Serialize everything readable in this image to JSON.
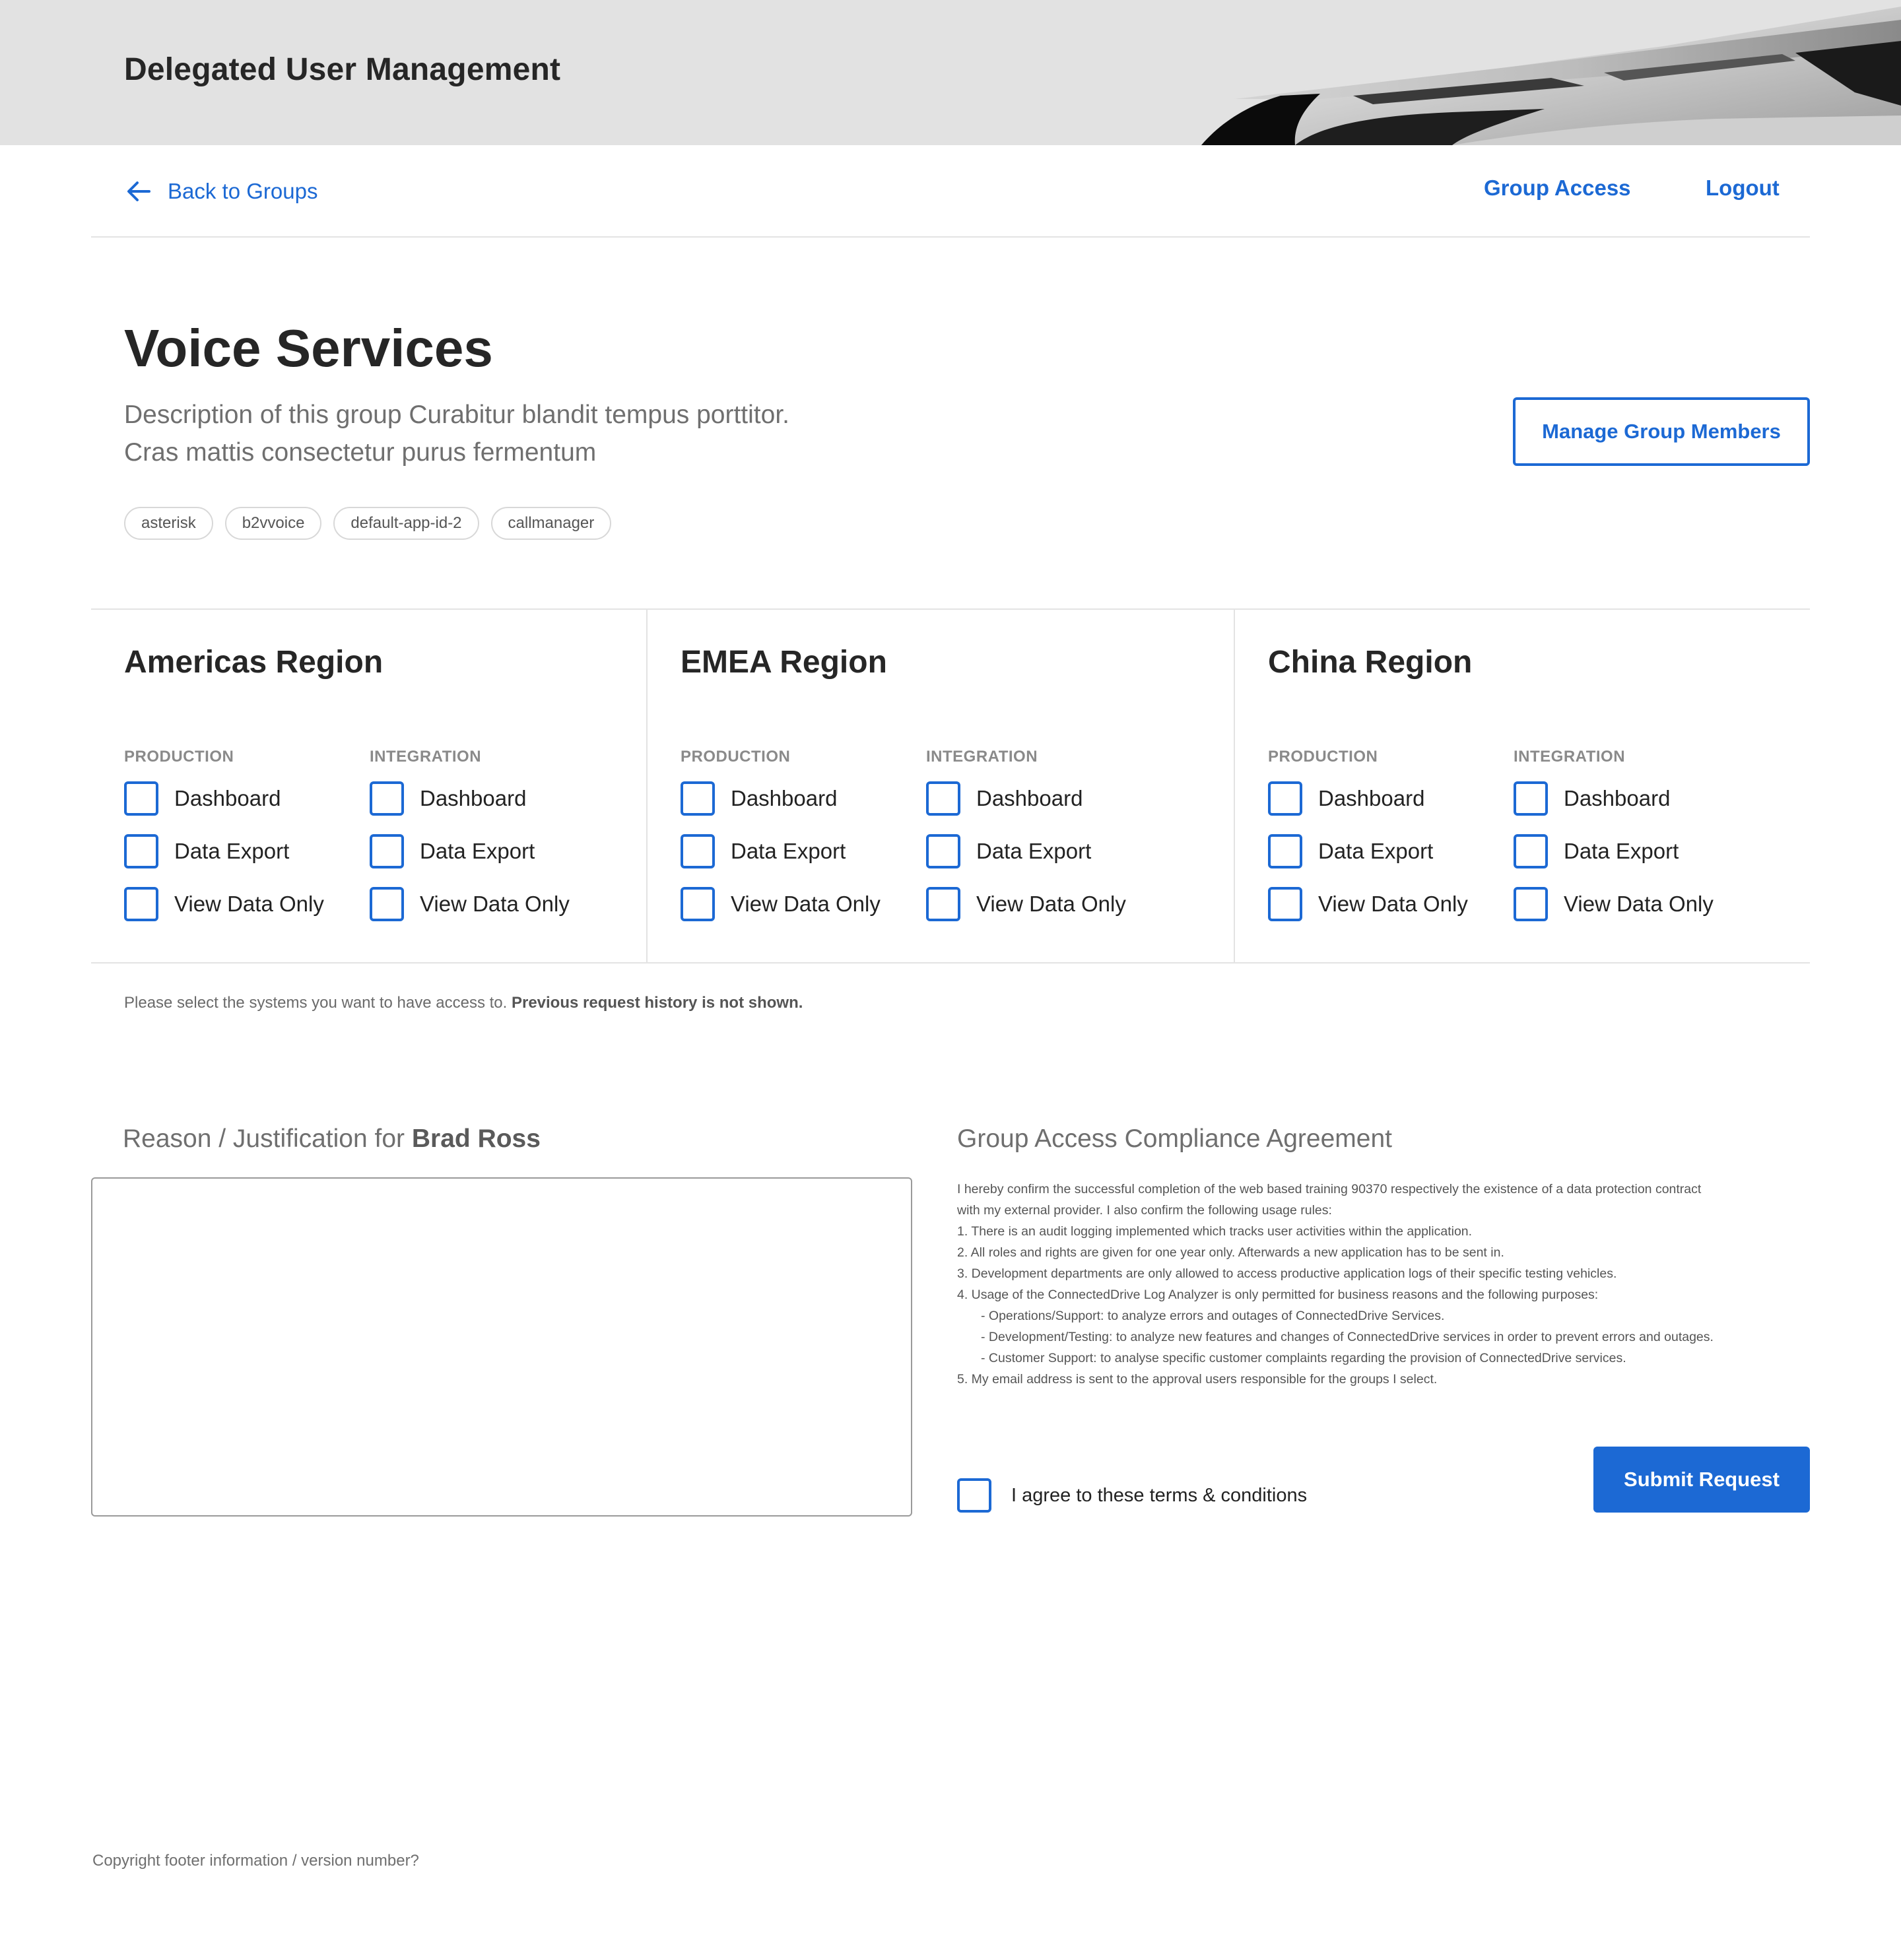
{
  "app": {
    "title": "Delegated User Management"
  },
  "nav": {
    "back_label": "Back to Groups",
    "group_access_label": "Group Access",
    "logout_label": "Logout"
  },
  "group": {
    "title": "Voice Services",
    "description_line1": "Description of this group Curabitur blandit tempus porttitor.",
    "description_line2": "Cras mattis consectetur purus fermentum",
    "manage_button": "Manage Group Members",
    "tags": [
      "asterisk",
      "b2vvoice",
      "default-app-id-2",
      "callmanager"
    ]
  },
  "regions": [
    {
      "title": "Americas Region",
      "columns": [
        {
          "label": "PRODUCTION",
          "options": [
            "Dashboard",
            "Data Export",
            "View Data Only"
          ]
        },
        {
          "label": "INTEGRATION",
          "options": [
            "Dashboard",
            "Data Export",
            "View Data Only"
          ]
        }
      ]
    },
    {
      "title": "EMEA Region",
      "columns": [
        {
          "label": "PRODUCTION",
          "options": [
            "Dashboard",
            "Data Export",
            "View Data Only"
          ]
        },
        {
          "label": "INTEGRATION",
          "options": [
            "Dashboard",
            "Data Export",
            "View Data Only"
          ]
        }
      ]
    },
    {
      "title": "China Region",
      "columns": [
        {
          "label": "PRODUCTION",
          "options": [
            "Dashboard",
            "Data Export",
            "View Data Only"
          ]
        },
        {
          "label": "INTEGRATION",
          "options": [
            "Dashboard",
            "Data Export",
            "View Data Only"
          ]
        }
      ]
    }
  ],
  "helper": {
    "text": "Please select the systems you want to have access to. ",
    "bold": "Previous request history is not shown."
  },
  "reason": {
    "label_prefix": "Reason / Justification for ",
    "user_name": "Brad Ross",
    "value": ""
  },
  "agreement": {
    "title": "Group Access Compliance Agreement",
    "lines": [
      "I hereby confirm the successful completion of the web based training 90370 respectively the existence of a data protection contract",
      "with my external provider. I also confirm the following usage rules:",
      "1. There is an audit logging implemented which tracks user activities within the application.",
      "2. All roles and rights are given for one year only. Afterwards a new application has to be sent in.",
      "3. Development departments are only allowed to access productive application logs of their specific testing vehicles.",
      "4. Usage of the ConnectedDrive Log Analyzer is only permitted for business reasons and the following purposes:",
      "- Operations/Support: to analyze errors and outages of ConnectedDrive Services.",
      "- Development/Testing: to analyze new features and changes of ConnectedDrive services in order to prevent errors and outages.",
      "- Customer Support: to analyse specific customer complaints regarding the provision of ConnectedDrive services.",
      "5. My email address is sent to the approval users responsible for the groups I select."
    ],
    "indented_lines": [
      6,
      7,
      8
    ],
    "checkbox_label": "I agree to these terms & conditions",
    "submit_label": "Submit Request"
  },
  "footer": {
    "text": "Copyright footer information / version number?"
  },
  "colors": {
    "accent": "#1c69d4",
    "header_bg": "#e2e2e2",
    "divider": "#e3e3e3"
  },
  "icons": {
    "back": "arrow-left-icon"
  }
}
